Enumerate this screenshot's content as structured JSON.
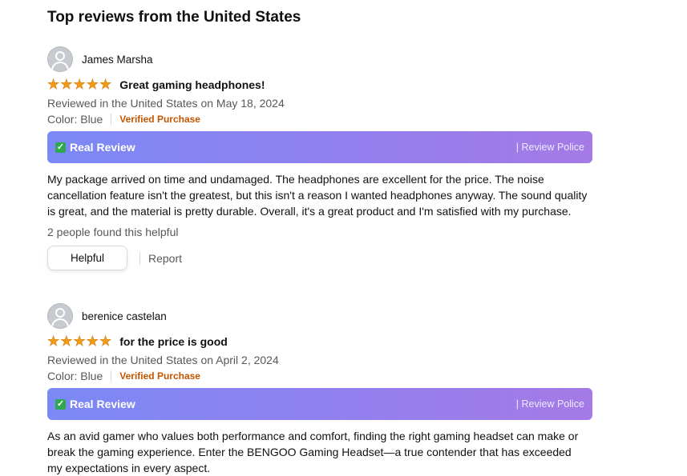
{
  "page": {
    "heading": "Top reviews from the United States"
  },
  "reviews": [
    {
      "reviewer": "James Marsha",
      "stars": 5,
      "title": "Great gaming headphones!",
      "reviewed": "Reviewed in the United States on May 18, 2024",
      "color": "Color: Blue",
      "verified": "Verified Purchase",
      "banner_left": "Real Review",
      "banner_right": "| Review Police",
      "body": "My package arrived on time and undamaged. The headphones are excellent for the price. The noise cancellation feature isn't the greatest, but this isn't a reason I wanted headphones anyway. The sound quality is great, and the material is pretty durable. Overall, it's a great product and I'm satisfied with my purchase.",
      "helpful_count": "2 people found this helpful",
      "helpful_label": "Helpful",
      "report_label": "Report"
    },
    {
      "reviewer": "berenice castelan",
      "stars": 5,
      "title": "for the price is good",
      "reviewed": "Reviewed in the United States on April 2, 2024",
      "color": "Color: Blue",
      "verified": "Verified Purchase",
      "banner_left": "Real Review",
      "banner_right": "| Review Police",
      "body": "As an avid gamer who values both performance and comfort, finding the right gaming headset can make or break the gaming experience. Enter the BENGOO Gaming Headset—a true contender that has exceeded my expectations in every aspect."
    }
  ],
  "icons": {
    "avatar": "user-avatar-icon",
    "star": "star-icon",
    "check": "check-mark-icon"
  },
  "colors": {
    "star": "#f29b16",
    "verified": "#c45500",
    "banner_start": "#7b89f6",
    "banner_end": "#a57ae6",
    "check": "#2fa84f"
  }
}
